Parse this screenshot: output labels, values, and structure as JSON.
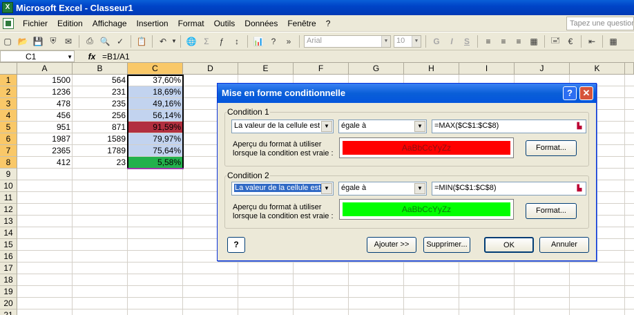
{
  "app": {
    "title": "Microsoft Excel - Classeur1",
    "icon": "excel-icon"
  },
  "menu": {
    "items": [
      "Fichier",
      "Edition",
      "Affichage",
      "Insertion",
      "Format",
      "Outils",
      "Données",
      "Fenêtre",
      "?"
    ],
    "help_placeholder": "Tapez une question"
  },
  "toolbar": {
    "font": "Arial",
    "size": "10",
    "bold": "G",
    "italic": "I",
    "underline": "S"
  },
  "formula_bar": {
    "cell_ref": "C1",
    "fx": "fx",
    "formula": "=B1/A1"
  },
  "sheet": {
    "columns": [
      "A",
      "B",
      "C",
      "D",
      "E",
      "F",
      "G",
      "H",
      "I",
      "J",
      "K"
    ],
    "rows": [
      "1",
      "2",
      "3",
      "4",
      "5",
      "6",
      "7",
      "8",
      "9",
      "10",
      "11",
      "12",
      "13",
      "14",
      "15",
      "16",
      "17",
      "18",
      "19",
      "20",
      "21"
    ],
    "data": [
      [
        "1500",
        "564",
        "37,60%"
      ],
      [
        "1236",
        "231",
        "18,69%"
      ],
      [
        "478",
        "235",
        "49,16%"
      ],
      [
        "456",
        "256",
        "56,14%"
      ],
      [
        "951",
        "871",
        "91,59%"
      ],
      [
        "1987",
        "1589",
        "79,97%"
      ],
      [
        "2365",
        "1789",
        "75,64%"
      ],
      [
        "412",
        "23",
        "5,58%"
      ]
    ],
    "highlight_colors": {
      "selection": "#c2d3ef",
      "max": "#b22f3f",
      "min": "#22b14c"
    }
  },
  "dialog": {
    "title": "Mise en forme conditionnelle",
    "condition1": {
      "legend": "Condition 1",
      "type": "La valeur de la cellule est",
      "operator": "égale à",
      "value": "=MAX($C$1:$C$8)",
      "apercu_line1": "Aperçu du format à utiliser",
      "apercu_line2": "lorsque la condition est vraie :",
      "preview_text": "AaBbCcYyZz",
      "preview_color": "#ff0000",
      "format_button": "Format..."
    },
    "condition2": {
      "legend": "Condition 2",
      "type": "La valeur de la cellule est",
      "operator": "égale à",
      "value": "=MIN($C$1:$C$8)",
      "apercu_line1": "Aperçu du format à utiliser",
      "apercu_line2": "lorsque la condition est vraie :",
      "preview_text": "AaBbCcYyZz",
      "preview_color": "#00ff00",
      "format_button": "Format..."
    },
    "buttons": {
      "add": "Ajouter >>",
      "delete": "Supprimer...",
      "ok": "OK",
      "cancel": "Annuler"
    }
  }
}
